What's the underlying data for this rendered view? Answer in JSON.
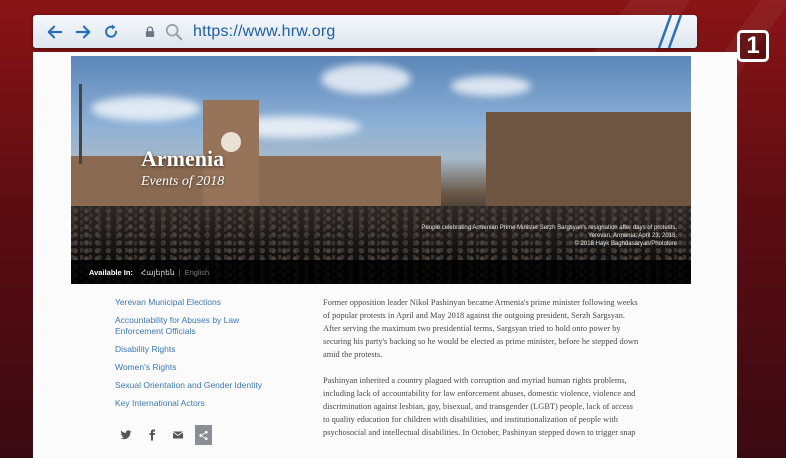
{
  "channel": {
    "logo_text": "1"
  },
  "browser": {
    "url": "https://www.hrw.org",
    "icons": [
      "back-arrow-icon",
      "forward-arrow-icon",
      "reload-icon",
      "lock-icon",
      "search-icon"
    ]
  },
  "hero": {
    "title": "Armenia",
    "subtitle": "Events of 2018",
    "caption_line1": "People celebrating Armenian Prime Minister Serzh Sargsyan's resignation after days of protests.",
    "caption_line2": "Yerevan, Armenia, April 23, 2018.",
    "caption_line3": "© 2018 Hayk Baghdasaryan/Photolure",
    "available_in_label": "Available In:",
    "lang_hy": "Հայերեն",
    "lang_separator": "|",
    "lang_en": "English"
  },
  "sidebar": {
    "items": [
      {
        "label": "Yerevan Municipal Elections"
      },
      {
        "label": "Accountability for Abuses by Law Enforcement Officials"
      },
      {
        "label": "Disability Rights"
      },
      {
        "label": "Women's Rights"
      },
      {
        "label": "Sexual Orientation and Gender Identity"
      },
      {
        "label": "Key International Actors"
      }
    ],
    "share_icons": [
      "twitter-icon",
      "facebook-icon",
      "email-icon",
      "share-icon"
    ]
  },
  "article": {
    "paragraphs": [
      "Former opposition leader Nikol Pashinyan became Armenia's prime minister following weeks of popular protests in April and May 2018 against the outgoing president, Serzh Sargsyan. After serving the maximum two presidential terms, Sargsyan tried to hold onto power by securing his party's backing so he would be elected as prime minister, before he stepped down amid the protests.",
      "Pashinyan inherited a country plagued with corruption and myriad human rights problems, including lack of accountability for law enforcement abuses, domestic violence, violence and discrimination against lesbian, gay, bisexual, and transgender (LGBT) people, lack of access to quality education for children with disabilities, and institutionalization of people with psychosocial and intellectual disabilities. In October, Pashinyan stepped down to trigger snap"
    ]
  },
  "colors": {
    "link": "#3a79b8",
    "url_text": "#1f5fa6",
    "tv_background": "#8a1416"
  }
}
